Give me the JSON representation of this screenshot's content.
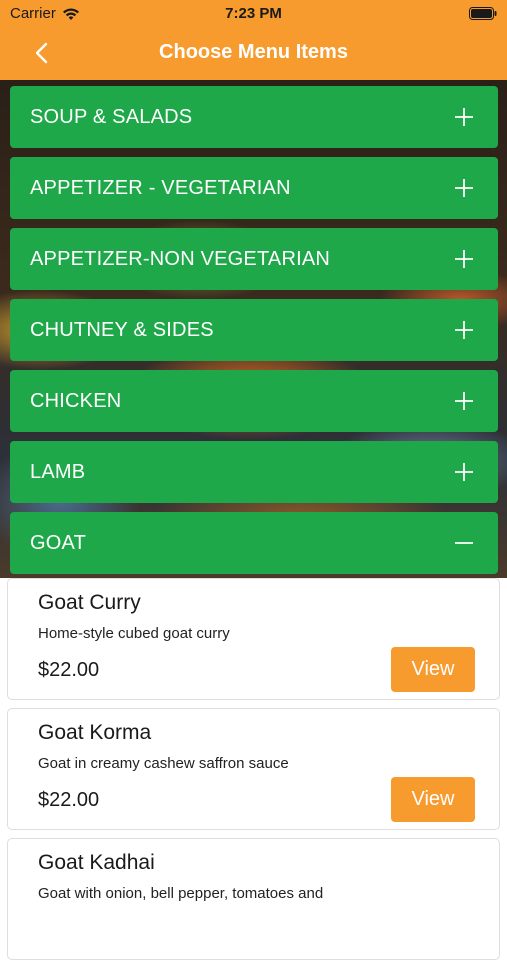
{
  "status_bar": {
    "carrier": "Carrier",
    "time": "7:23 PM"
  },
  "nav": {
    "title": "Choose Menu Items",
    "back_icon": "chevron-left-icon"
  },
  "colors": {
    "accent_orange": "#F79B2E",
    "category_green": "#1FA84A"
  },
  "categories": [
    {
      "label": "SOUP & SALADS",
      "expanded": false
    },
    {
      "label": "APPETIZER - VEGETARIAN",
      "expanded": false
    },
    {
      "label": "APPETIZER-NON VEGETARIAN",
      "expanded": false
    },
    {
      "label": "CHUTNEY & SIDES",
      "expanded": false
    },
    {
      "label": "CHICKEN",
      "expanded": false
    },
    {
      "label": "LAMB",
      "expanded": false
    },
    {
      "label": "GOAT",
      "expanded": true
    }
  ],
  "items": [
    {
      "name": "Goat Curry",
      "description": "Home-style cubed goat curry",
      "price": "$22.00",
      "button": "View"
    },
    {
      "name": "Goat Korma",
      "description": "Goat in creamy cashew saffron sauce",
      "price": "$22.00",
      "button": "View"
    },
    {
      "name": "Goat Kadhai",
      "description": "Goat with onion, bell pepper, tomatoes and",
      "price": "",
      "button": ""
    }
  ]
}
